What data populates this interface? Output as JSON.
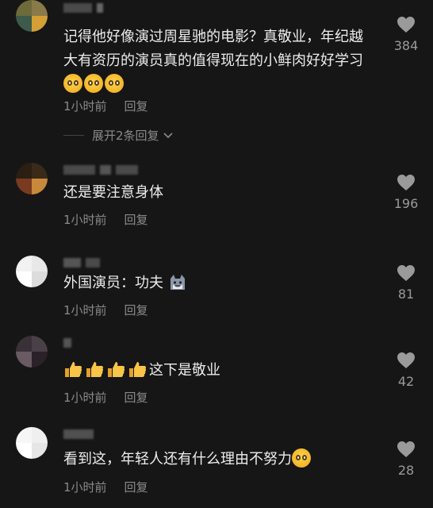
{
  "comments": [
    {
      "text": "记得他好像演过周星驰的电影？真敬业，年纪越大有资历的演员真的值得现在的小鲜肉好好学习",
      "emoji_after": [
        "pleading-face-emoji",
        "pleading-face-emoji",
        "pleading-face-emoji"
      ],
      "time": "1小时前",
      "reply": "回复",
      "likes": "384",
      "expand": "展开2条回复"
    },
    {
      "text": "还是要注意身体",
      "time": "1小时前",
      "reply": "回复",
      "likes": "196"
    },
    {
      "text": "外国演员：功夫",
      "emoji_after": [
        "cat-face-emoji"
      ],
      "time": "1小时前",
      "reply": "回复",
      "likes": "81"
    },
    {
      "emoji_before": [
        "thumbs-up-emoji",
        "thumbs-up-emoji",
        "thumbs-up-emoji",
        "thumbs-up-emoji"
      ],
      "text": "这下是敬业",
      "time": "1小时前",
      "reply": "回复",
      "likes": "42"
    },
    {
      "text": "看到这，年轻人还有什么理由不努力",
      "emoji_after": [
        "pleading-face-emoji"
      ],
      "time": "1小时前",
      "reply": "回复",
      "likes": "28"
    }
  ],
  "icons": {
    "like": "heart-icon",
    "expand": "chevron-down-icon"
  },
  "colors": {
    "background": "#161616",
    "text": "#ededed",
    "meta": "#8a8a8a",
    "like": "#9a9a9a"
  }
}
